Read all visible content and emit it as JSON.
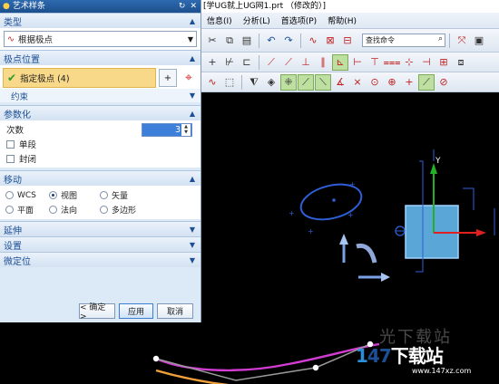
{
  "app": {
    "title": "[学UG就上UG网1.prt （修改的）]",
    "menus": [
      "信息(I)",
      "分析(L)",
      "首选项(P)",
      "帮助(H)"
    ],
    "search_placeholder": "查找命令"
  },
  "dialog": {
    "title": "艺术样条",
    "sections": {
      "type": {
        "label": "类型",
        "selected": "根据极点"
      },
      "pole_position": {
        "label": "极点位置",
        "select_label": "指定极点 (4)",
        "constraint_label": "约束"
      },
      "parameterization": {
        "label": "参数化",
        "degree_label": "次数",
        "degree_value": "3",
        "single_segment_label": "单段",
        "closed_label": "封闭"
      },
      "movement": {
        "label": "移动",
        "options": [
          "WCS",
          "视图",
          "矢量",
          "平面",
          "法向",
          "多边形"
        ],
        "selected": "视图"
      },
      "extension": {
        "label": "延伸"
      },
      "settings": {
        "label": "设置"
      },
      "fine_position": {
        "label": "微定位"
      }
    },
    "buttons": {
      "ok": "< 确定 >",
      "apply": "应用",
      "cancel": "取消"
    }
  },
  "viewport": {
    "axis_label": "Y"
  },
  "watermark": {
    "url": "www.147xz.com",
    "faint_text": "光下载站"
  },
  "colors": {
    "dialog_bg": "#dce9f6",
    "section_header": "#1d4f94",
    "pole_highlight": "#f8d889",
    "spline": "#d23cd2",
    "axis_y": "#24b024",
    "axis_x": "#e02020",
    "axis_z": "#2f5fd8"
  }
}
